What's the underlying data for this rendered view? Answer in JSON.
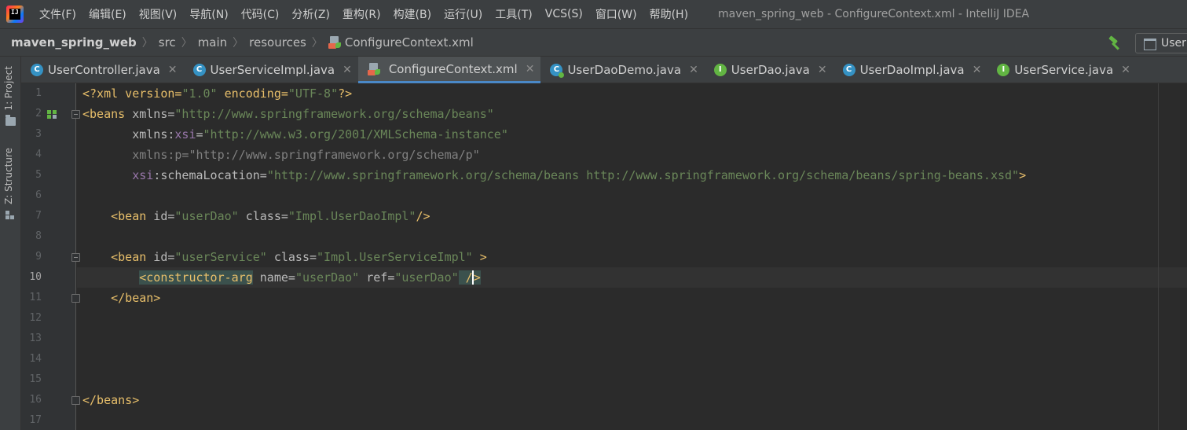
{
  "menubar": {
    "logo_text": "IJ",
    "items": [
      "文件(F)",
      "编辑(E)",
      "视图(V)",
      "导航(N)",
      "代码(C)",
      "分析(Z)",
      "重构(R)",
      "构建(B)",
      "运行(U)",
      "工具(T)",
      "VCS(S)",
      "窗口(W)",
      "帮助(H)"
    ],
    "window_title": "maven_spring_web - ConfigureContext.xml - IntelliJ IDEA"
  },
  "breadcrumb": {
    "project": "maven_spring_web",
    "src": "src",
    "main": "main",
    "resources": "resources",
    "file": "ConfigureContext.xml",
    "run_config_label": "User"
  },
  "sidebar": {
    "project_tab": "1: Project",
    "structure_tab": "Z: Structure"
  },
  "tabs": [
    {
      "label": "UserController.java",
      "icon": "class-icon",
      "active": false
    },
    {
      "label": "UserServiceImpl.java",
      "icon": "class-icon",
      "active": false
    },
    {
      "label": "ConfigureContext.xml",
      "icon": "xml-file-icon",
      "active": true
    },
    {
      "label": "UserDaoDemo.java",
      "icon": "main-class-icon",
      "active": false
    },
    {
      "label": "UserDao.java",
      "icon": "interface-icon",
      "active": false
    },
    {
      "label": "UserDaoImpl.java",
      "icon": "class-icon",
      "active": false
    },
    {
      "label": "UserService.java",
      "icon": "interface-icon",
      "active": false
    }
  ],
  "editor": {
    "line_numbers": [
      "1",
      "2",
      "3",
      "4",
      "5",
      "6",
      "7",
      "8",
      "9",
      "10",
      "11",
      "12",
      "13",
      "14",
      "15",
      "16",
      "17"
    ],
    "current_line": "10",
    "code": {
      "l1": {
        "a": "<?xml version=",
        "b": "\"1.0\"",
        "c": " encoding=",
        "d": "\"UTF-8\"",
        "e": "?>"
      },
      "l2": {
        "tag": "<beans",
        "attr": " xmlns=",
        "val": "\"http://www.springframework.org/schema/beans\""
      },
      "l3": {
        "indent": "       ",
        "attr": "xmlns:",
        "ns": "xsi",
        "eq": "=",
        "val": "\"http://www.w3.org/2001/XMLSchema-instance\""
      },
      "l4": {
        "indent": "       ",
        "text": "xmlns:p=\"http://www.springframework.org/schema/p\""
      },
      "l5": {
        "indent": "       ",
        "ns": "xsi",
        "attr": ":schemaLocation=",
        "val": "\"http://www.springframework.org/schema/beans http://www.springframework.org/schema/beans/spring-beans.xsd\"",
        "close": ">"
      },
      "l7": {
        "indent": "    ",
        "tag": "<bean",
        "a1": " id=",
        "v1": "\"userDao\"",
        "a2": " class=",
        "v2": "\"Impl.UserDaoImpl\"",
        "close": "/>"
      },
      "l9": {
        "indent": "    ",
        "tag": "<bean",
        "a1": " id=",
        "v1": "\"userService\"",
        "a2": " class=",
        "v2": "\"Impl.UserServiceImpl\"",
        "close": " >"
      },
      "l10": {
        "indent": "        ",
        "tag": "<constructor-arg",
        "a1": " name=",
        "v1": "\"userDao\"",
        "a2": " ref=",
        "v2": "\"userDao\"",
        "close_a": " /",
        "close_b": ">"
      },
      "l11": {
        "indent": "    ",
        "tag": "</bean>"
      },
      "l16": {
        "tag": "</beans>"
      }
    }
  },
  "colors": {
    "background": "#2b2b2b",
    "chrome": "#3c3f41",
    "tag": "#e8bf6a",
    "value": "#6a8759",
    "namespace": "#9876aa",
    "active_tab_underline": "#4a88c7"
  }
}
